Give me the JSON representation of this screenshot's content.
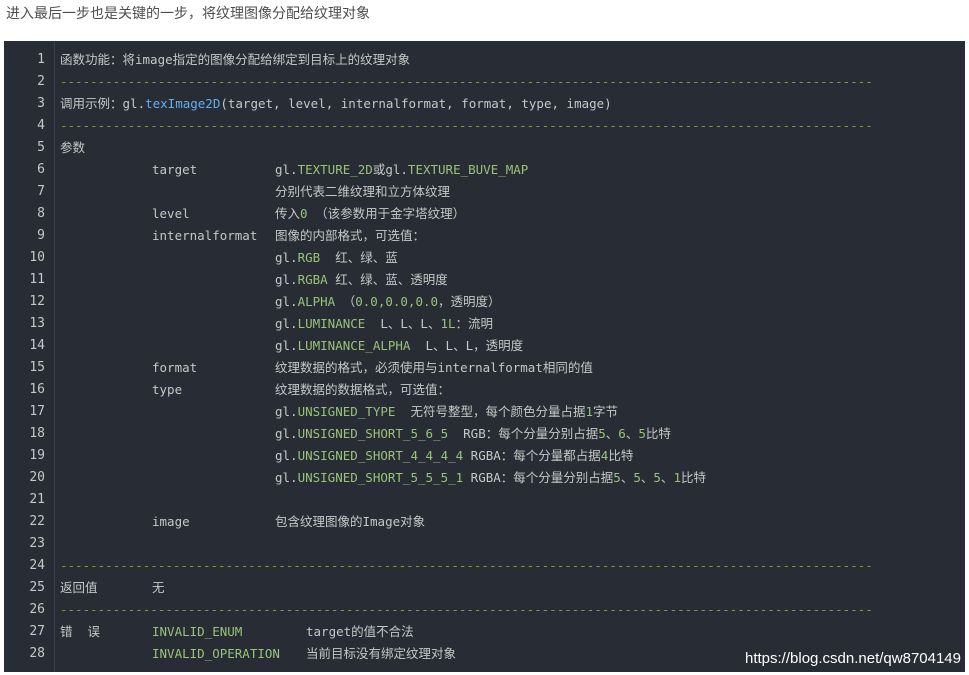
{
  "intro": "进入最后一步也是关键的一步，将纹理图像分配给纹理对象",
  "gutter": [
    "1",
    "2",
    "3",
    "4",
    "5",
    "6",
    "7",
    "8",
    "9",
    "10",
    "11",
    "12",
    "13",
    "14",
    "15",
    "16",
    "17",
    "18",
    "19",
    "20",
    "21",
    "22",
    "23",
    "24",
    "25",
    "26",
    "27",
    "28"
  ],
  "dashes": "------------------------------------------------------------------------------------------------------------",
  "l1": "函数功能：将image指定的图像分配给绑定到目标上的纹理对象",
  "l3": {
    "a": "调用示例：",
    "b": "gl.",
    "c": "texImage2D",
    "d": "(target, level, internalformat, format, type, image)"
  },
  "l5": "参数",
  "l6": {
    "name": "target",
    "a": "gl.",
    "b": "TEXTURE_2D",
    "c": "或gl.",
    "d": "TEXTURE_BUVE_MAP"
  },
  "l7": "分别代表二维纹理和立方体纹理",
  "l8": {
    "name": "level",
    "a": "传入",
    "b": "0",
    "c": " （该参数用于金字塔纹理）"
  },
  "l9": {
    "name": "internalformat",
    "a": "图像的内部格式，可选值："
  },
  "l10": {
    "a": "gl.",
    "b": "RGB",
    "c": "  红、绿、蓝"
  },
  "l11": {
    "a": "gl.",
    "b": "RGBA",
    "c": " 红、绿、蓝、透明度"
  },
  "l12": {
    "a": "gl.",
    "b": "ALPHA",
    "c": " （",
    "d": "0.0,0.0,0.0",
    "e": "，透明度）"
  },
  "l13": {
    "a": "gl.",
    "b": "LUMINANCE",
    "c": "  L、L、L、",
    "d": "1L",
    "e": "：流明"
  },
  "l14": {
    "a": "gl.",
    "b": "LUMINANCE_ALPHA",
    "c": "  L、L、L，透明度"
  },
  "l15": {
    "name": "format",
    "a": "纹理数据的格式，必须使用与internalformat相同的值"
  },
  "l16": {
    "name": "type",
    "a": "纹理数据的数据格式，可选值："
  },
  "l17": {
    "a": "gl.",
    "b": "UNSIGNED_TYPE",
    "c": "  无符号整型，每个颜色分量占据",
    "d": "1",
    "e": "字节"
  },
  "l18": {
    "a": "gl.",
    "b": "UNSIGNED_SHORT_5_6_5",
    "c": "  RGB：每个分量分别占据",
    "d": "5",
    "e": "、",
    "f": "6",
    "g": "、",
    "h": "5",
    "i": "比特"
  },
  "l19": {
    "a": "gl.",
    "b": "UNSIGNED_SHORT_4_4_4_4",
    "c": " RGBA：每个分量都占据",
    "d": "4",
    "e": "比特"
  },
  "l20": {
    "a": "gl.",
    "b": "UNSIGNED_SHORT_5_5_5_1",
    "c": " RGBA：每个分量分别占据",
    "d": "5",
    "e": "、",
    "f": "5",
    "g": "、",
    "h": "5",
    "i": "、",
    "j": "1",
    "k": "比特"
  },
  "l22": {
    "name": "image",
    "a": "包含纹理图像的Image对象"
  },
  "l25": {
    "label": "返回值",
    "value": "无"
  },
  "l27": {
    "label": "错  误",
    "name": "INVALID_ENUM",
    "desc": "target的值不合法"
  },
  "l28": {
    "name": "INVALID_OPERATION",
    "desc": "当前目标没有绑定纹理对象"
  },
  "watermark": "https://blog.csdn.net/qw8704149",
  "colors": {
    "background": "#282c34",
    "text": "#c5c8c6",
    "constant": "#98c379",
    "function": "#61afef",
    "dash": "#8a9a2a"
  }
}
